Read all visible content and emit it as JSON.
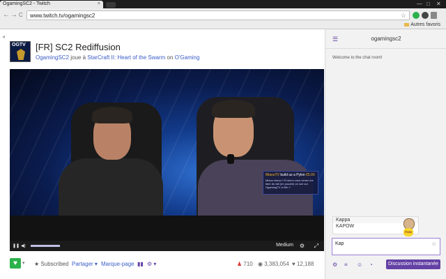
{
  "browser": {
    "tab_title": "OgamingSC2 - Twitch",
    "tab_close": "×",
    "window_controls": [
      "—",
      "□",
      "✕"
    ],
    "url": "www.twitch.tv/ogamingsc2",
    "back_icon": "←",
    "forward_icon": "→",
    "reload_icon": "C",
    "star_icon": "☆",
    "bookmarks_label": "Autres favoris"
  },
  "stream": {
    "logo_text": "OGTV",
    "title": "[FR] SC2 Rediffusion",
    "channel": "OgamingSC2",
    "plays_text": " joue à ",
    "game": "StarCraft II: Heart of the Swarm",
    "on_text": " on ",
    "network": "O'Gaming"
  },
  "player": {
    "overlay_user": "MiaouTV",
    "overlay_text": " build us a Pylon ",
    "overlay_amount": "€5.00",
    "overlay_msg": "Miaou miaou ! Et sinon vous venez me faire du lait (en poudre) ce soir sur OgamingTV à 00h ?",
    "play_icon": "❚❚",
    "volume_icon": "◀)",
    "volume_level": 1.0,
    "quality": "Medium",
    "settings_icon": "⚙",
    "fullscreen_icon": "⤢"
  },
  "actions": {
    "follow_icon": "♥",
    "caret": "▾",
    "subscribed": "Subscribed",
    "share": "Partager",
    "bookmark": "Marque-page",
    "viewers": "710",
    "views": "3,383,054",
    "followers": "12,188"
  },
  "chat": {
    "menu_icon": "☰",
    "channel": "ogamingsc2",
    "welcome": "Welcome to the chat room!",
    "suggestions": [
      "Kappa",
      "KAPOW"
    ],
    "kapow_text": "POW",
    "input_value": "Kap",
    "send_label": "Discussion instantanée",
    "smile_icon": "☺"
  },
  "colors": {
    "brand_purple": "#6441a5",
    "follow_green": "#2db14b",
    "link_blue": "#3a5cc6"
  }
}
